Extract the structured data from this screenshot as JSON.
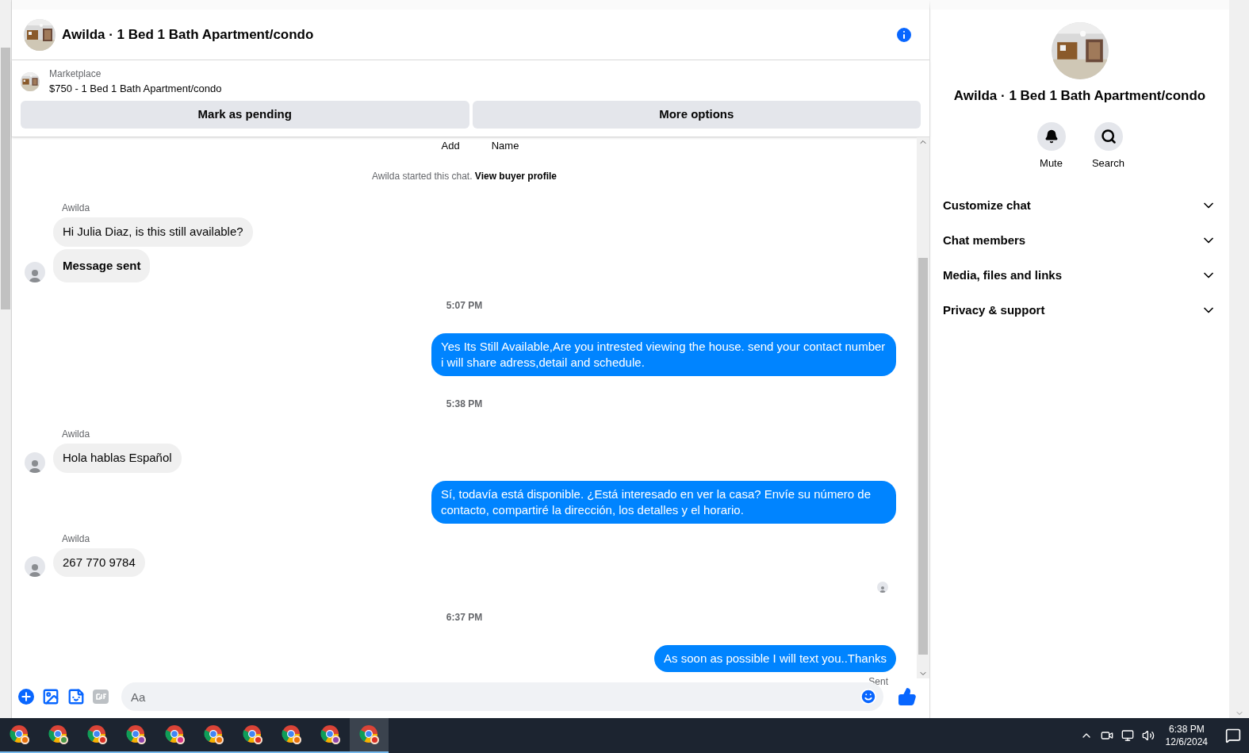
{
  "header": {
    "title": "Awilda · 1 Bed 1 Bath Apartment/condo"
  },
  "listing": {
    "source": "Marketplace",
    "title": "$750 - 1 Bed 1 Bath Apartment/condo",
    "buttons": [
      "Mark as pending",
      "More options"
    ]
  },
  "cut_labels": [
    "Add",
    "Name"
  ],
  "messages": [
    {
      "kind": "system",
      "text": "Awilda started this chat.",
      "link": "View buyer profile"
    },
    {
      "kind": "incoming",
      "sender": "Awilda",
      "bubbles": [
        {
          "text": "Hi Julia Diaz, is this still available?",
          "bold": false
        },
        {
          "text": "Message sent",
          "bold": true
        }
      ]
    },
    {
      "kind": "time",
      "text": "5:07 PM"
    },
    {
      "kind": "outgoing",
      "text": "Yes Its Still Available,Are you intrested viewing the house. send your contact number i will share adress,detail and schedule."
    },
    {
      "kind": "time",
      "text": "5:38 PM"
    },
    {
      "kind": "incoming",
      "sender": "Awilda",
      "bubbles": [
        {
          "text": "Hola hablas Español",
          "bold": false
        }
      ]
    },
    {
      "kind": "outgoing",
      "text": "Sí, todavía está disponible. ¿Está interesado en ver la casa? Envíe su número de contacto, compartiré la dirección, los detalles y el horario."
    },
    {
      "kind": "incoming",
      "sender": "Awilda",
      "bubbles": [
        {
          "text": "267 770 9784",
          "bold": false
        }
      ]
    },
    {
      "kind": "seen"
    },
    {
      "kind": "time",
      "text": "6:37 PM"
    },
    {
      "kind": "outgoing",
      "text": "As soon as possible I will text you..Thanks",
      "status": "Sent"
    }
  ],
  "composer": {
    "placeholder": "Aa"
  },
  "panel": {
    "title": "Awilda · 1 Bed 1 Bath Apartment/condo",
    "actions": [
      {
        "kind": "mute",
        "label": "Mute"
      },
      {
        "kind": "search",
        "label": "Search"
      }
    ],
    "sections": [
      {
        "label": "Customize chat",
        "expanded": false
      },
      {
        "label": "Chat members",
        "expanded": false
      },
      {
        "label": "Media, files and links",
        "expanded": false
      },
      {
        "label": "Privacy & support",
        "expanded": false
      }
    ]
  },
  "taskbar": {
    "apps": [
      {
        "color": "#e8710a",
        "selected": false
      },
      {
        "color": "#4a9a4a",
        "selected": false
      },
      {
        "color": "#d93025",
        "selected": false
      },
      {
        "color": "#8e44ad",
        "selected": false
      },
      {
        "color": "#d63384",
        "selected": false
      },
      {
        "color": "#e8710a",
        "selected": false
      },
      {
        "color": "#d93025",
        "selected": false
      },
      {
        "color": "#e8710a",
        "selected": false
      },
      {
        "color": "#8e44ad",
        "selected": false
      },
      {
        "color": "#d93025",
        "selected": true
      }
    ],
    "time": "6:38 PM",
    "date": "12/6/2024"
  }
}
